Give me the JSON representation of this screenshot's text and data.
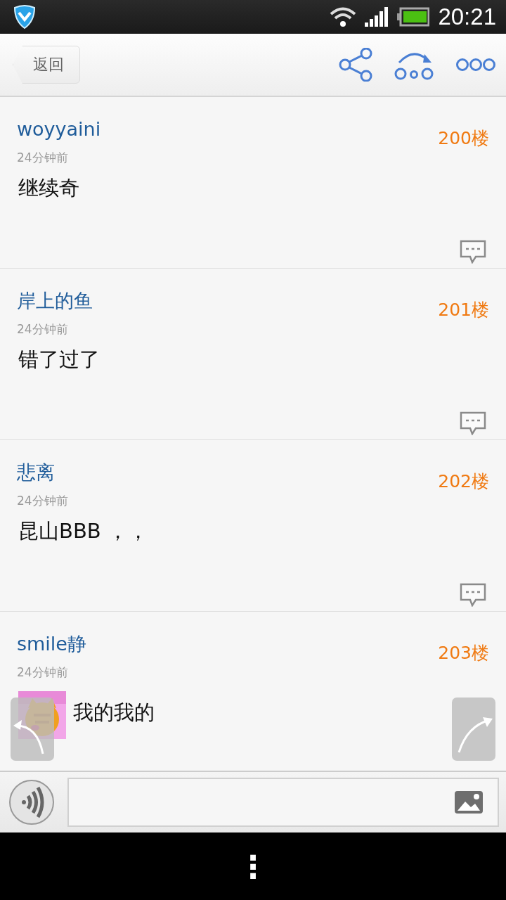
{
  "status_bar": {
    "time": "20:21"
  },
  "header": {
    "back_label": "返回"
  },
  "posts": [
    {
      "author": "woyyaini",
      "time": "24分钟前",
      "floor": "200楼",
      "text": "继续奇",
      "sticker": false,
      "reply_button": true
    },
    {
      "author": "岸上的鱼",
      "time": "24分钟前",
      "floor": "201楼",
      "text": "错了过了",
      "sticker": false,
      "reply_button": true
    },
    {
      "author": "悲离",
      "time": "24分钟前",
      "floor": "202楼",
      "text": "昆山BBB ，，",
      "sticker": false,
      "reply_button": true
    },
    {
      "author": "smile静",
      "time": "24分钟前",
      "floor": "203楼",
      "text": "我的我的",
      "sticker": true,
      "reply_button": false
    }
  ],
  "reply_bar": {
    "voice": true
  },
  "nav_bar": {
    "menu": "⋮"
  }
}
